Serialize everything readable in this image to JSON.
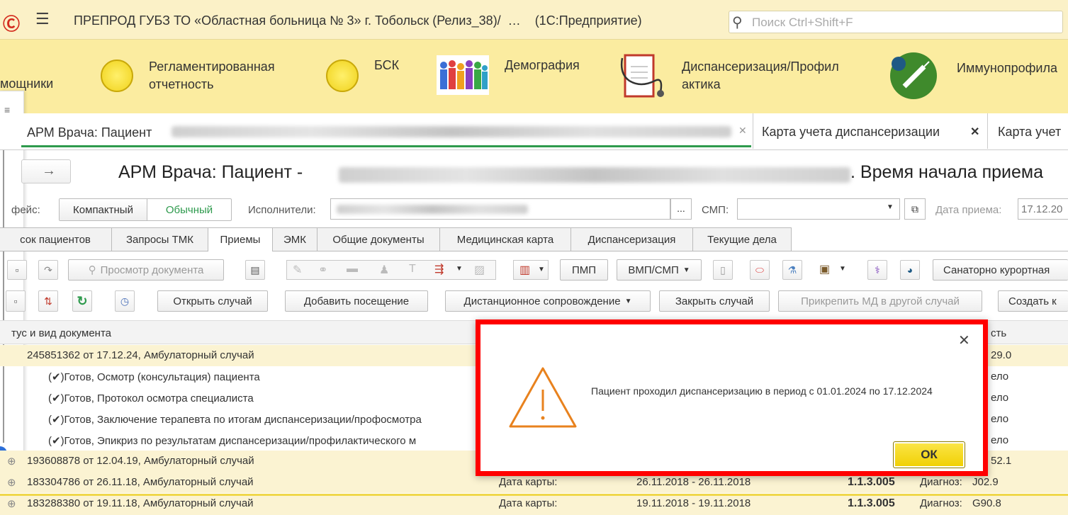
{
  "app": {
    "title": "ПРЕПРОД ГУБЗ ТО «Областная больница № 3» г. Тобольск (Релиз_38)/  …    (1С:Предприятие)",
    "search_placeholder": "Поиск Ctrl+Shift+F"
  },
  "sections": [
    {
      "label": "мощники",
      "icon": "helpers-icon"
    },
    {
      "label": "Регламентированная\nотчетность",
      "icon": "yellow-circle-icon"
    },
    {
      "label": "БСК",
      "icon": "yellow-circle-icon"
    },
    {
      "label": "Демография",
      "icon": "people-icon"
    },
    {
      "label": "Диспансеризация/Профил\nактика",
      "icon": "medical-card-icon"
    },
    {
      "label": "Иммунопрофила",
      "icon": "vaccine-icon"
    }
  ],
  "open_tabs": [
    {
      "label": "АРМ Врача: Пациент",
      "active": true
    },
    {
      "label": "Карта учета диспансеризации",
      "closable": true
    },
    {
      "label": "Карта учет"
    }
  ],
  "page": {
    "title_prefix": "АРМ Врача: Пациент -",
    "title_suffix": ". Время начала приема"
  },
  "filters": {
    "interface_label": "фейс:",
    "compact_label": "Компактный",
    "normal_label": "Обычный",
    "performers_label": "Исполнители:",
    "smp_label": "СМП:",
    "date_label": "Дата приема:",
    "date_value": "17.12.20"
  },
  "inner_tabs": [
    "сок пациентов",
    "Запросы ТМК",
    "Приемы",
    "ЭМК",
    "Общие документы",
    "Медицинская карта",
    "Диспансеризация",
    "Текущие дела"
  ],
  "active_inner_tab": "Приемы",
  "toolbar1": {
    "view_doc": "Просмотр документа",
    "pmp": "ПМП",
    "vmp": "ВМП/СМП",
    "sanatorium": "Санаторно курортная"
  },
  "toolbar2": {
    "open_case": "Открыть случай",
    "add_visit": "Добавить посещение",
    "remote": "Дистанционное сопровождение",
    "close_case": "Закрыть случай",
    "attach": "Прикрепить МД в другой случай",
    "create": "Создать к"
  },
  "table": {
    "header_col1": "тус и вид документа",
    "header_col_right": "сть",
    "rows": [
      {
        "text": "245851362 от 17.12.24, Амбулаторный случай",
        "right": "29.0",
        "type": "case"
      },
      {
        "text": "(✔)Готов, Осмотр (консультация) пациента",
        "right": "ело",
        "type": "doc"
      },
      {
        "text": "(✔)Готов, Протокол осмотра специалиста",
        "right": "ело",
        "type": "doc"
      },
      {
        "text": "(✔)Готов, Заключение терапевта по итогам диспансеризации/профосмотра",
        "right": "ело",
        "type": "doc"
      },
      {
        "text": "(✔)Готов, Эпикриз по результатам диспансеризации/профилактического м",
        "right": "ело",
        "type": "doc"
      },
      {
        "text": "193608878 от 12.04.19, Амбулаторный случай",
        "right": "52.1",
        "type": "case"
      },
      {
        "text": "183304786 от 26.11.18, Амбулаторный случай",
        "date_label": "Дата карты:",
        "period": "26.11.2018 - 26.11.2018",
        "code": "1.1.3.005",
        "diag_label": "Диагноз:",
        "diag": "J02.9",
        "type": "case"
      },
      {
        "text": "183288380 от 19.11.18, Амбулаторный случай",
        "date_label": "Дата карты:",
        "period": "19.11.2018 - 19.11.2018",
        "code": "1.1.3.005",
        "diag_label": "Диагноз:",
        "diag": "G90.8",
        "type": "case"
      }
    ]
  },
  "dialog": {
    "message": "Пациент проходил диспансеризацию в период с 01.01.2024 по 17.12.2024",
    "ok_label": "ОК"
  },
  "colors": {
    "accent_yellow": "#fbeca0",
    "title_bg": "#fbf1c7",
    "ok_button": "#f6d80e",
    "highlight_red": "#ff0000",
    "warning": "#e8821e"
  }
}
